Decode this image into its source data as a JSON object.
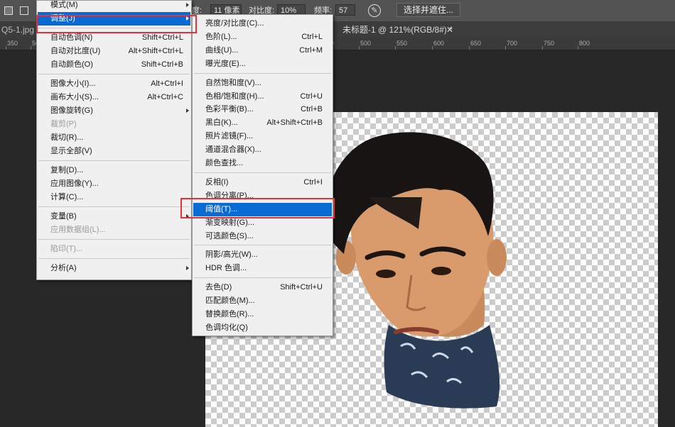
{
  "options_bar": {
    "width_label": "度:",
    "width_value": "11 像素",
    "contrast_label": "对比度:",
    "contrast_value": "10%",
    "frequency_label": "频率:",
    "frequency_value": "57",
    "select_mask_button": "选择并遮住..."
  },
  "tabs": [
    {
      "label": "Q5-1.jpg"
    },
    {
      "label": "未标题-1 @ 121%(RGB/8#) *"
    }
  ],
  "ruler": [
    "350",
    "50",
    "100",
    "150",
    "200",
    "250",
    "300",
    "350",
    "400",
    "450",
    "500",
    "550",
    "600",
    "650",
    "700",
    "750",
    "800"
  ],
  "image_menu": [
    {
      "label": "模式(M)",
      "shortcut": "",
      "submenu": true
    },
    {
      "label": "调整(J)",
      "shortcut": "",
      "submenu": true,
      "highlight": true
    },
    {
      "label": "自动色调(N)",
      "shortcut": "Shift+Ctrl+L"
    },
    {
      "label": "自动对比度(U)",
      "shortcut": "Alt+Shift+Ctrl+L"
    },
    {
      "label": "自动颜色(O)",
      "shortcut": "Shift+Ctrl+B"
    },
    {
      "label": "图像大小(I)...",
      "shortcut": "Alt+Ctrl+I"
    },
    {
      "label": "画布大小(S)...",
      "shortcut": "Alt+Ctrl+C"
    },
    {
      "label": "图像旋转(G)",
      "shortcut": "",
      "submenu": true
    },
    {
      "label": "裁剪(P)",
      "shortcut": "",
      "disabled": true
    },
    {
      "label": "裁切(R)...",
      "shortcut": ""
    },
    {
      "label": "显示全部(V)",
      "shortcut": ""
    },
    {
      "label": "复制(D)...",
      "shortcut": ""
    },
    {
      "label": "应用图像(Y)...",
      "shortcut": ""
    },
    {
      "label": "计算(C)...",
      "shortcut": ""
    },
    {
      "label": "变量(B)",
      "shortcut": "",
      "submenu": true
    },
    {
      "label": "应用数据组(L)...",
      "shortcut": "",
      "disabled": true
    },
    {
      "label": "陷印(T)...",
      "shortcut": "",
      "disabled": true
    },
    {
      "label": "分析(A)",
      "shortcut": "",
      "submenu": true
    }
  ],
  "adjust_menu": [
    {
      "label": "亮度/对比度(C)...",
      "shortcut": ""
    },
    {
      "label": "色阶(L)...",
      "shortcut": "Ctrl+L"
    },
    {
      "label": "曲线(U)...",
      "shortcut": "Ctrl+M"
    },
    {
      "label": "曝光度(E)...",
      "shortcut": ""
    },
    {
      "label": "自然饱和度(V)...",
      "shortcut": ""
    },
    {
      "label": "色相/饱和度(H)...",
      "shortcut": "Ctrl+U"
    },
    {
      "label": "色彩平衡(B)...",
      "shortcut": "Ctrl+B"
    },
    {
      "label": "黑白(K)...",
      "shortcut": "Alt+Shift+Ctrl+B"
    },
    {
      "label": "照片滤镜(F)...",
      "shortcut": ""
    },
    {
      "label": "通道混合器(X)...",
      "shortcut": ""
    },
    {
      "label": "颜色查找...",
      "shortcut": ""
    },
    {
      "label": "反相(I)",
      "shortcut": "Ctrl+I"
    },
    {
      "label": "色调分离(P)...",
      "shortcut": ""
    },
    {
      "label": "阈值(T)...",
      "shortcut": "",
      "highlight": true
    },
    {
      "label": "渐变映射(G)...",
      "shortcut": ""
    },
    {
      "label": "可选颜色(S)...",
      "shortcut": ""
    },
    {
      "label": "阴影/高光(W)...",
      "shortcut": ""
    },
    {
      "label": "HDR 色调...",
      "shortcut": ""
    },
    {
      "label": "去色(D)",
      "shortcut": "Shift+Ctrl+U"
    },
    {
      "label": "匹配颜色(M)...",
      "shortcut": ""
    },
    {
      "label": "替换颜色(R)...",
      "shortcut": ""
    },
    {
      "label": "色调均化(Q)",
      "shortcut": ""
    }
  ],
  "colors": {
    "highlight": "#0a6ad4",
    "annotation": "#e8303a",
    "workspace": "#282828"
  }
}
